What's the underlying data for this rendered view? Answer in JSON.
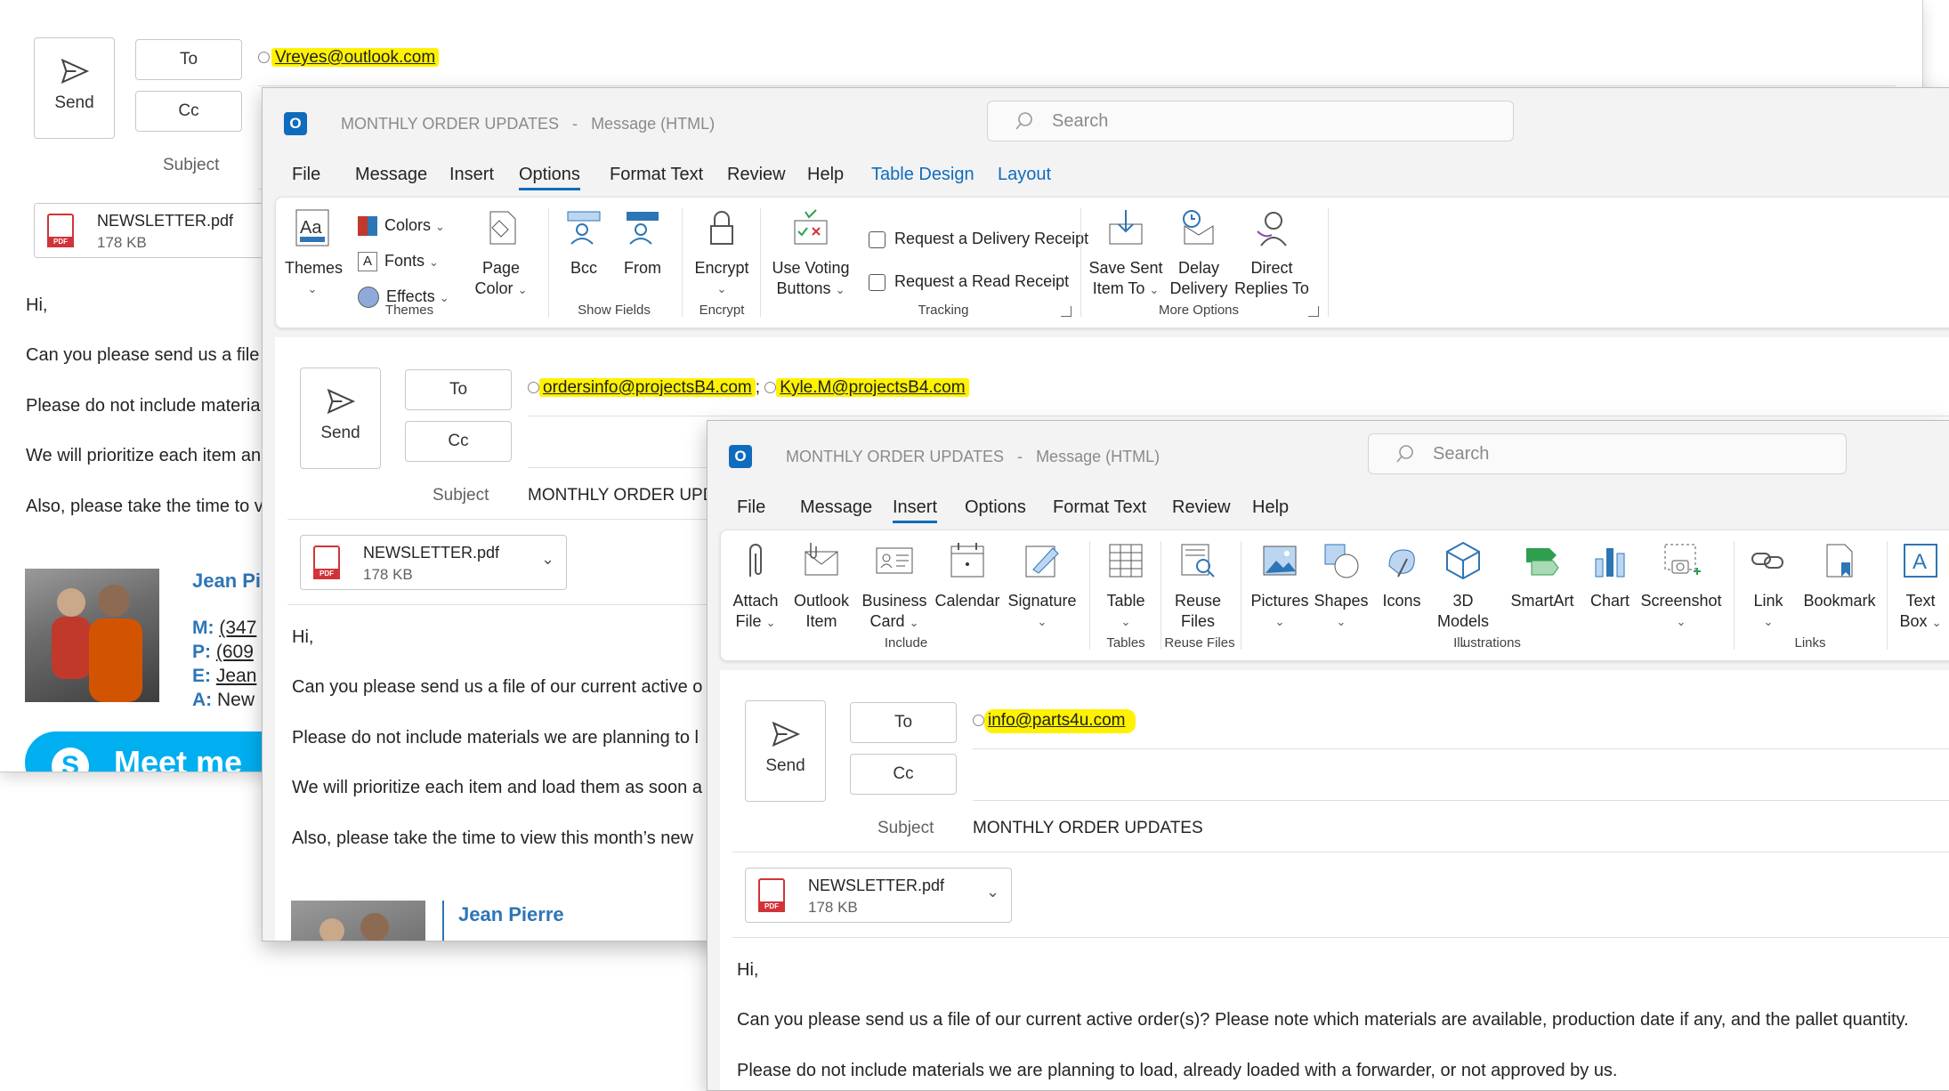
{
  "common": {
    "send_label": "Send",
    "to_label": "To",
    "cc_label": "Cc",
    "subject_label": "Subject",
    "window_title": "MONTHLY ORDER UPDATES",
    "window_title_sep": "-",
    "window_mode": "Message (HTML)",
    "search_placeholder": "Search",
    "attachment_name": "NEWSLETTER.pdf",
    "attachment_size": "178 KB",
    "pdf_badge": "PDF",
    "subject_value": "MONTHLY ORDER UPDATES"
  },
  "window1": {
    "to_address": "Vreyes@outlook.com",
    "subject_partial": "",
    "body": {
      "greeting": "Hi,",
      "line1": "Can you please send us a file o",
      "line2": "Please do not include materia",
      "line3": "We will prioritize each item an",
      "line4": "Also, please take the time to v"
    },
    "signature": {
      "name": "Jean Pi",
      "m_label": "M:",
      "m_value": "(347",
      "p_label": "P:",
      "p_value": "(609",
      "e_label": "E:",
      "e_value": "Jean",
      "a_label": "A:",
      "a_value": "New"
    },
    "banner_text": "Meet me"
  },
  "window2": {
    "menu": [
      "File",
      "Message",
      "Insert",
      "Options",
      "Format Text",
      "Review",
      "Help",
      "Table Design",
      "Layout"
    ],
    "active_tab": "Options",
    "ribbon": {
      "themes": "Themes",
      "colors": "Colors",
      "fonts": "Fonts",
      "effects": "Effects",
      "page_color_1": "Page",
      "page_color_2": "Color",
      "group_themes": "Themes",
      "bcc": "Bcc",
      "from": "From",
      "group_show_fields": "Show Fields",
      "encrypt": "Encrypt",
      "group_encrypt": "Encrypt",
      "use_voting_1": "Use Voting",
      "use_voting_2": "Buttons",
      "delivery_receipt": "Request a Delivery Receipt",
      "read_receipt": "Request a Read Receipt",
      "group_tracking": "Tracking",
      "save_sent_1": "Save Sent",
      "save_sent_2": "Item To",
      "delay_1": "Delay",
      "delay_2": "Delivery",
      "direct_1": "Direct",
      "direct_2": "Replies To",
      "group_more_options": "More Options"
    },
    "to_address_1": "ordersinfo@projectsB4.com",
    "to_sep": ";",
    "to_address_2": "Kyle.M@projectsB4.com",
    "subject_partial": "MONTHLY ORDER UPDA",
    "body": {
      "greeting": "Hi,",
      "line1": "Can you please send us a file of our current active o",
      "line2": "Please do not include materials we are planning to l",
      "line3": "We will prioritize each item and load them as soon a",
      "line4": "Also, please take the time to view this month’s new"
    },
    "signature_name": "Jean Pierre"
  },
  "window3": {
    "menu": [
      "File",
      "Message",
      "Insert",
      "Options",
      "Format Text",
      "Review",
      "Help"
    ],
    "active_tab": "Insert",
    "ribbon": {
      "attach_1": "Attach",
      "attach_2": "File",
      "outlook_1": "Outlook",
      "outlook_2": "Item",
      "business_1": "Business",
      "business_2": "Card",
      "calendar": "Calendar",
      "signature": "Signature",
      "group_include": "Include",
      "table": "Table",
      "group_tables": "Tables",
      "reuse_1": "Reuse",
      "reuse_2": "Files",
      "group_reuse": "Reuse Files",
      "pictures": "Pictures",
      "shapes": "Shapes",
      "icons": "Icons",
      "models_1": "3D",
      "models_2": "Models",
      "smartart": "SmartArt",
      "chart": "Chart",
      "screenshot": "Screenshot",
      "group_illustrations": "Illustrations",
      "link": "Link",
      "bookmark": "Bookmark",
      "group_links": "Links",
      "textbox_1": "Text",
      "textbox_2": "Box"
    },
    "to_address": "info@parts4u.com",
    "body": {
      "greeting": "Hi,",
      "line1": "Can you please send us a file of our current active order(s)? Please note which materials are available, production date if any, and the pallet quantity.",
      "line2": "Please do not include materials we are planning to load, already loaded with a forwarder, or not approved by us."
    }
  },
  "colors": {
    "highlight": "#fff200",
    "accent": "#0f6cbd",
    "pdf_red": "#d13438",
    "signature_blue": "#2e75b6"
  }
}
